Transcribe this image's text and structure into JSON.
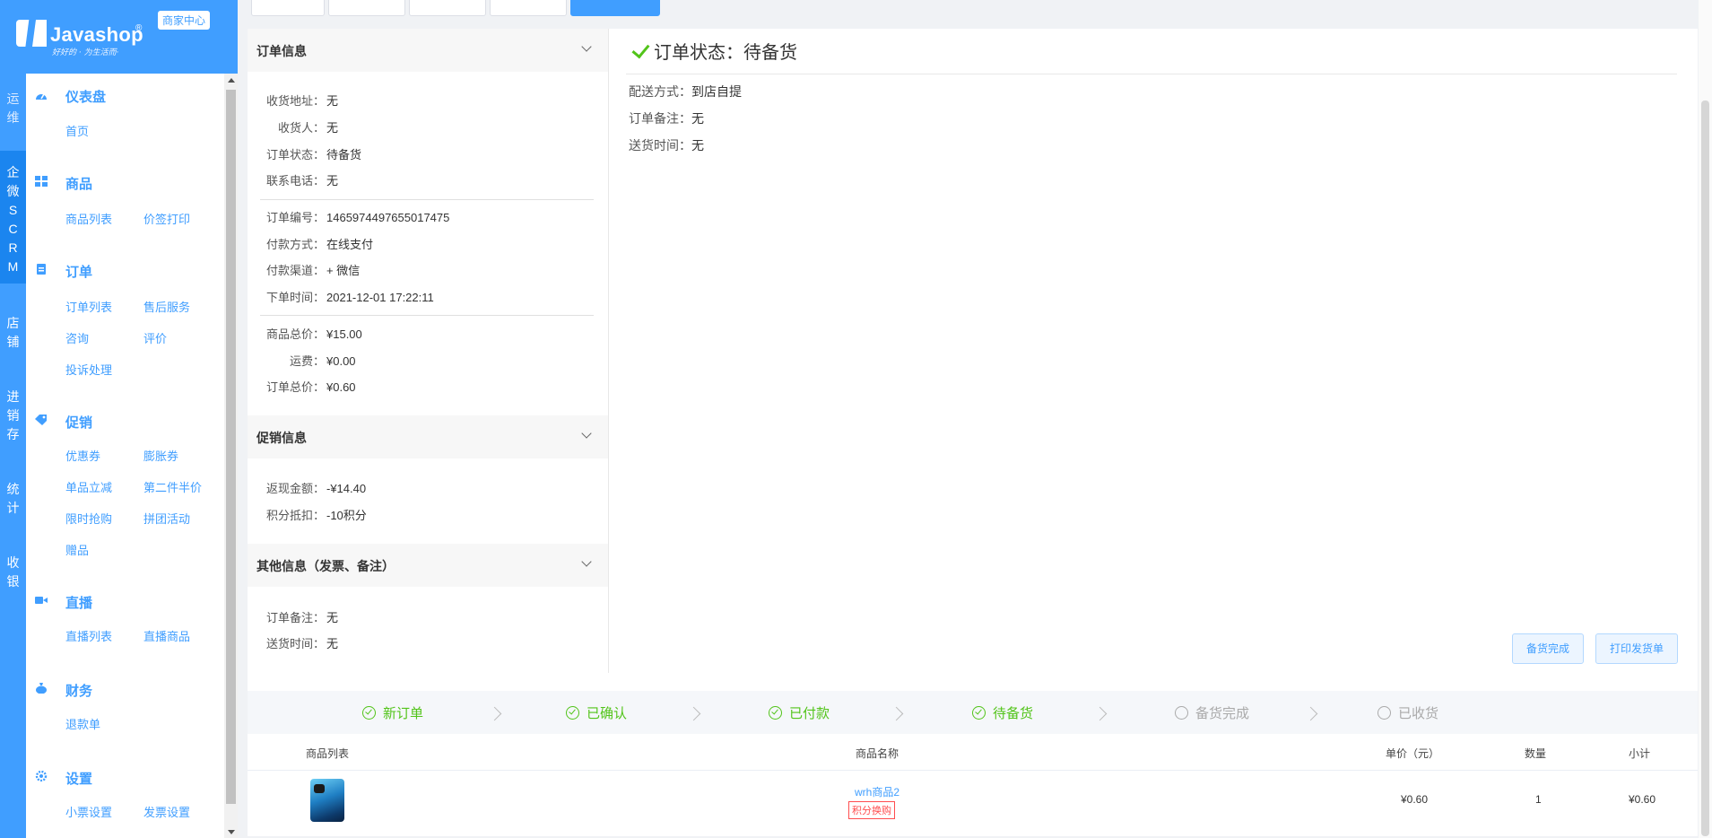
{
  "brand": {
    "name": "Javashop",
    "registered": "®",
    "slogan": "好好的 · 为生活而·",
    "center_badge": "商家中心"
  },
  "rail": {
    "items": [
      {
        "label": "运维"
      },
      {
        "label": "企微SCRM"
      },
      {
        "label": "店铺"
      },
      {
        "label": "进销存"
      },
      {
        "label": "统计"
      },
      {
        "label": "收银"
      }
    ]
  },
  "menu": {
    "groups": [
      {
        "title": "仪表盘",
        "icon": "dashboard-icon",
        "links": [
          "首页"
        ]
      },
      {
        "title": "商品",
        "icon": "grid-icon",
        "links": [
          "商品列表",
          "价签打印"
        ]
      },
      {
        "title": "订单",
        "icon": "clipboard-icon",
        "links": [
          "订单列表",
          "售后服务",
          "咨询",
          "评价",
          "投诉处理"
        ]
      },
      {
        "title": "促销",
        "icon": "tag-icon",
        "links": [
          "优惠券",
          "膨胀券",
          "单品立减",
          "第二件半价",
          "限时抢购",
          "拼团活动",
          "赠品"
        ]
      },
      {
        "title": "直播",
        "icon": "video-icon",
        "links": [
          "直播列表",
          "直播商品"
        ]
      },
      {
        "title": "财务",
        "icon": "money-bag-icon",
        "links": [
          "退款单"
        ]
      },
      {
        "title": "设置",
        "icon": "gear-icon",
        "links": [
          "小票设置",
          "发票设置"
        ]
      }
    ]
  },
  "order_info": {
    "section_title": "订单信息",
    "rows": [
      {
        "label": "收货地址：",
        "value": "无"
      },
      {
        "label": "收货人：",
        "value": "无"
      },
      {
        "label": "订单状态：",
        "value": "待备货"
      },
      {
        "label": "联系电话：",
        "value": "无"
      },
      {
        "label": "订单编号：",
        "value": "1465974497655017475"
      },
      {
        "label": "付款方式：",
        "value": "在线支付"
      },
      {
        "label": "付款渠道：",
        "value": "+ 微信"
      },
      {
        "label": "下单时间：",
        "value": "2021-12-01 17:22:11"
      },
      {
        "label": "商品总价：",
        "value": "¥15.00"
      },
      {
        "label": "运费：",
        "value": "¥0.00"
      },
      {
        "label": "订单总价：",
        "value": "¥0.60"
      }
    ]
  },
  "promo_info": {
    "section_title": "促销信息",
    "rows": [
      {
        "label": "返现金额：",
        "value": "-¥14.40"
      },
      {
        "label": "积分抵扣：",
        "value": "-10积分"
      }
    ]
  },
  "other_info": {
    "section_title": "其他信息（发票、备注）",
    "rows": [
      {
        "label": "订单备注：",
        "value": "无"
      },
      {
        "label": "送货时间：",
        "value": "无"
      }
    ]
  },
  "status_panel": {
    "title": "订单状态：待备货",
    "rows": [
      {
        "label": "配送方式：",
        "value": "到店自提"
      },
      {
        "label": "订单备注：",
        "value": "无"
      },
      {
        "label": "送货时间：",
        "value": "无"
      }
    ],
    "buttons": {
      "ready": "备货完成",
      "print": "打印发货单"
    }
  },
  "steps": [
    {
      "label": "新订单",
      "done": true
    },
    {
      "label": "已确认",
      "done": true
    },
    {
      "label": "已付款",
      "done": true
    },
    {
      "label": "待备货",
      "done": true
    },
    {
      "label": "备货完成",
      "done": false
    },
    {
      "label": "已收货",
      "done": false
    }
  ],
  "goods_table": {
    "headers": [
      "商品列表",
      "商品名称",
      "单价（元）",
      "数量",
      "小计"
    ],
    "rows": [
      {
        "name": "wrh商品2",
        "tag": "积分换购",
        "price": "¥0.60",
        "qty": "1",
        "subtotal": "¥0.60"
      }
    ]
  },
  "colors": {
    "primary": "#409eff",
    "success": "#52c41a",
    "danger": "#ff4d4f"
  }
}
